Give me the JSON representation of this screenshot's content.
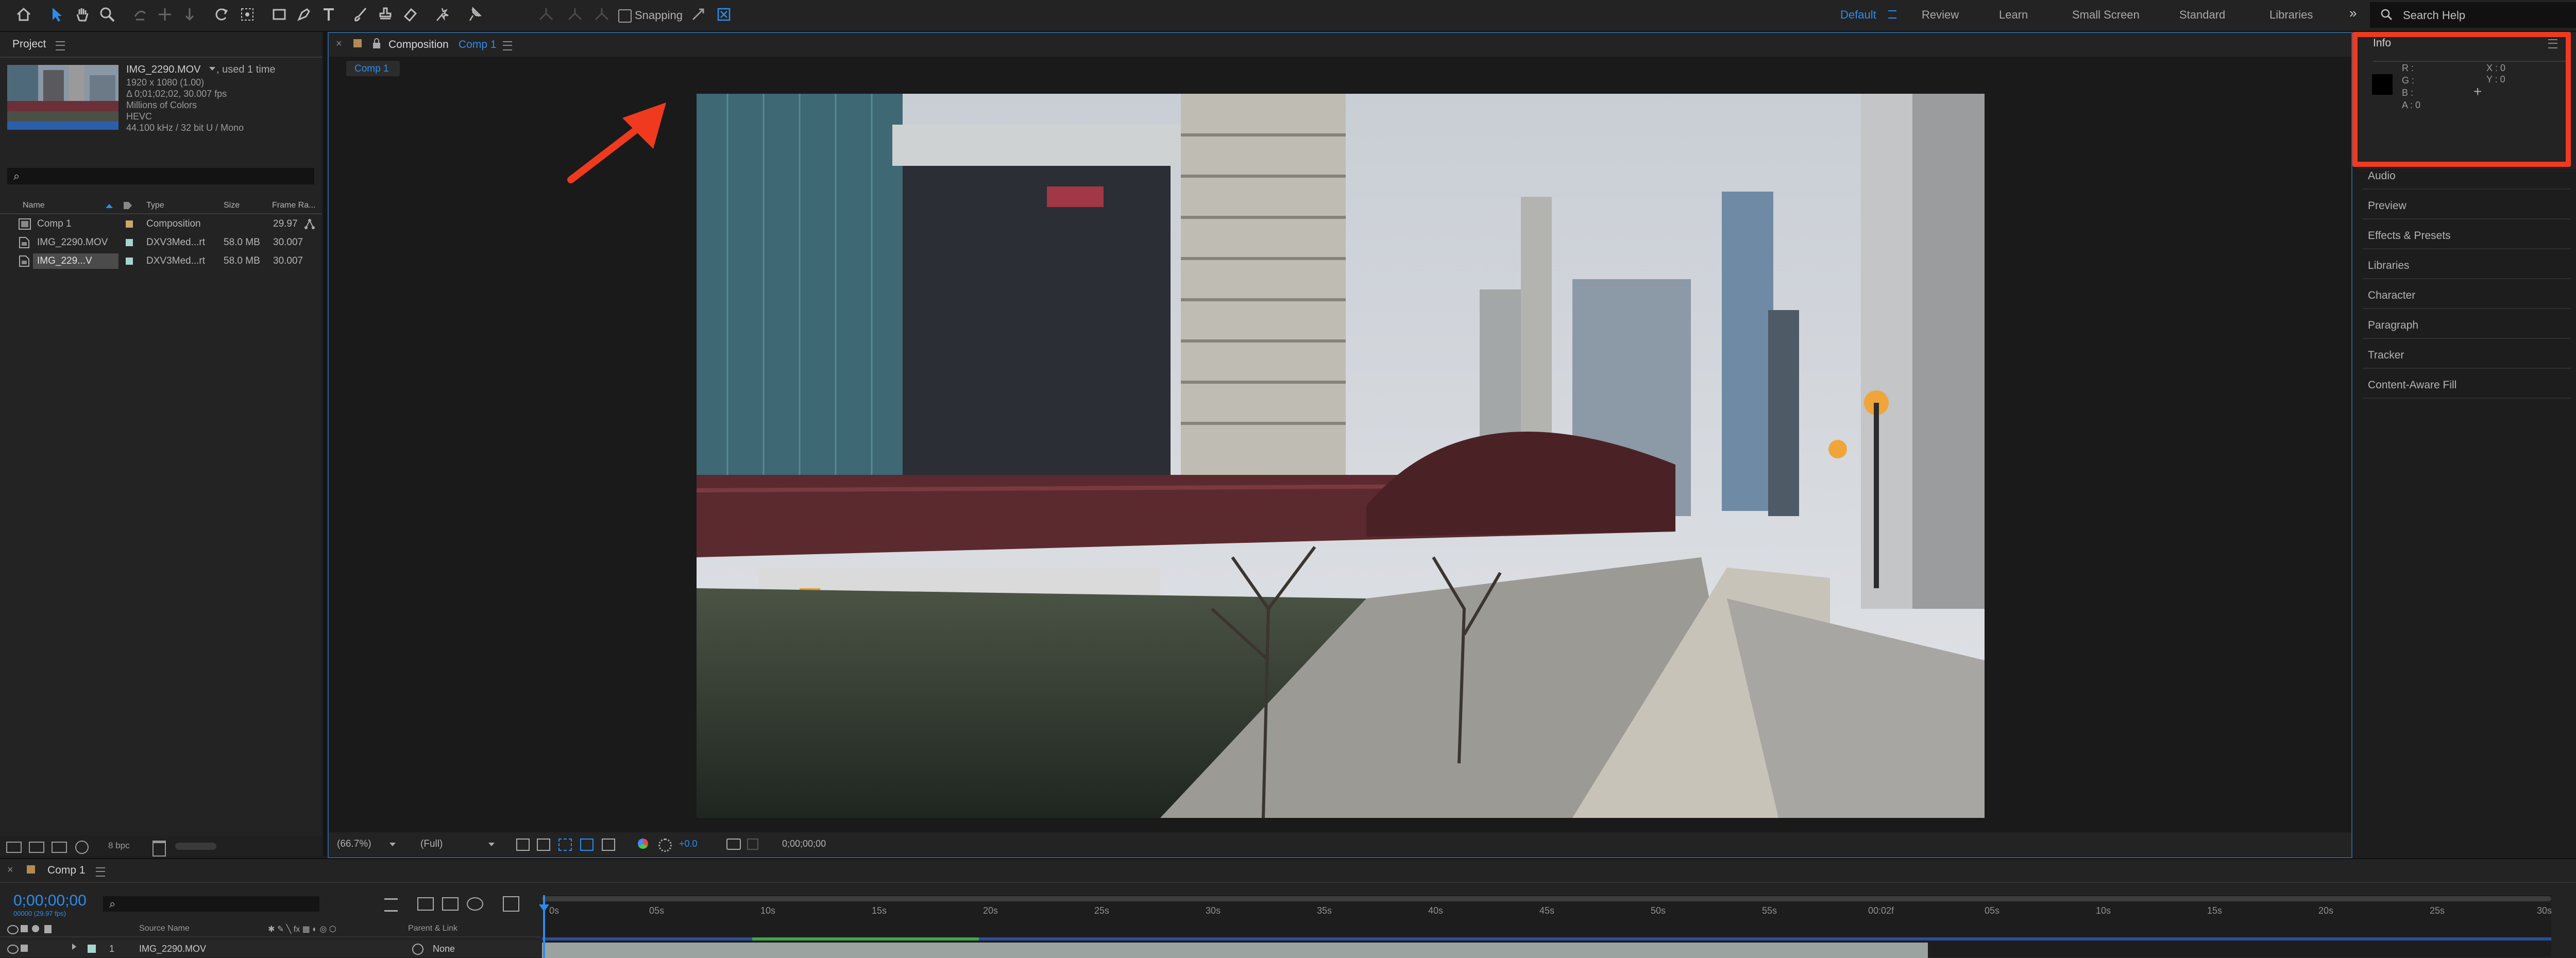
{
  "toolbar": {
    "snapping_label": "Snapping",
    "workspaces": [
      "Default",
      "Review",
      "Learn",
      "Small Screen",
      "Standard",
      "Libraries"
    ],
    "active_workspace": "Default",
    "more_label": "»",
    "search_placeholder": "Search Help"
  },
  "project": {
    "title": "Project",
    "item_name": "IMG_2290.MOV",
    "item_usage": ", used 1 time",
    "info_lines": [
      "1920 x 1080 (1.00)",
      "Δ 0;01;02;02, 30.007 fps",
      "Millions of Colors",
      "HEVC",
      "44.100 kHz / 32 bit U / Mono"
    ],
    "search_placeholder": "⌕",
    "columns": [
      "Name",
      "Type",
      "Size",
      "Frame Ra..."
    ],
    "rows": [
      {
        "name": "Comp 1",
        "type": "Composition",
        "size": "",
        "fps": "29.97",
        "swatch": "#c9a86a"
      },
      {
        "name": "IMG_2290.MOV",
        "type": "DXV3Med...rt",
        "size": "58.0 MB",
        "fps": "30.007",
        "swatch": "#a5d6ce"
      },
      {
        "name": "IMG_229...V",
        "type": "DXV3Med...rt",
        "size": "58.0 MB",
        "fps": "30.007",
        "swatch": "#a5d6ce"
      }
    ],
    "bpc": "8 bpc"
  },
  "composition": {
    "tab_prefix": "Composition",
    "tab_name": "Comp 1",
    "subtab": "Comp 1",
    "zoom": "(66.7%)",
    "resolution": "(Full)",
    "exposure": "+0.0",
    "timecode": "0;00;00;00"
  },
  "info_panel": {
    "title": "Info",
    "r": "R :",
    "g": "G :",
    "b": "B :",
    "a": "A :  0",
    "x": "X : 0",
    "y": "Y : 0"
  },
  "right_panels": [
    "Audio",
    "Preview",
    "Effects & Presets",
    "Libraries",
    "Character",
    "Paragraph",
    "Tracker",
    "Content-Aware Fill"
  ],
  "timeline": {
    "tab": "Comp 1",
    "timecode": "0;00;00;00",
    "subtimecode": "00000 (29.97 fps)",
    "search_placeholder": "⌕",
    "col_source": "Source Name",
    "col_parent": "Parent & Link",
    "layer_num": "1",
    "layer_name": "IMG_2290.MOV",
    "parent_value": "None",
    "ruler": [
      "0s",
      "05s",
      "10s",
      "15s",
      "20s",
      "25s",
      "30s",
      "35s",
      "40s",
      "45s",
      "50s",
      "55s",
      "00:02f",
      "05s",
      "10s",
      "15s",
      "20s",
      "25s",
      "30s"
    ]
  },
  "colors": {
    "accent": "#2d8ceb",
    "annotation": "#f03a1f"
  }
}
